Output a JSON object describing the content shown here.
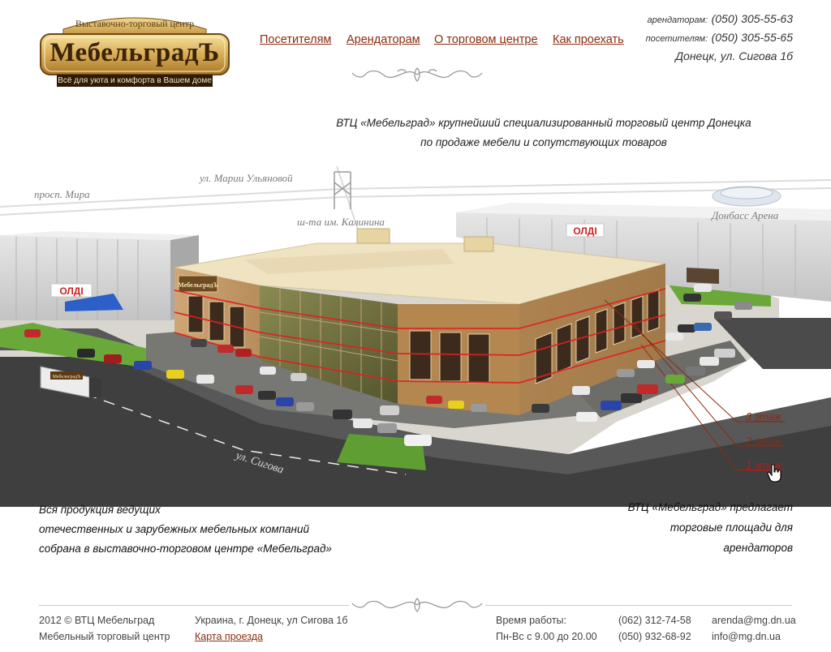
{
  "brand": {
    "subtitle": "Выставочно-торговый центр",
    "name": "МебельградЪ",
    "tagline": "Всё для уюта и комфорта в Вашем доме"
  },
  "nav": [
    {
      "label": "Посетителям"
    },
    {
      "label": "Арендаторам"
    },
    {
      "label": "О торговом центре"
    },
    {
      "label": "Как проехать"
    }
  ],
  "contacts": {
    "tenants_label": "арендаторам:",
    "tenants_phone": "(050) 305-55-63",
    "visitors_label": "посетителям:",
    "visitors_phone": "(050) 305-55-65",
    "address": "Донецк, ул. Сигова 1б"
  },
  "intro": {
    "line1": "ВТЦ «Мебельград» крупнейший специализированный торговый центр Донецка",
    "line2": "по продаже мебели и сопутствующих товаров"
  },
  "map": {
    "streets": {
      "mira": "просп. Мира",
      "ulyanovoy": "ул. Марии Ульяновой",
      "kalinina": "ш-та им. Калинина",
      "donbass_arena": "Донбасс Арена",
      "sigova": "ул. Сигова"
    },
    "store_sign": "ОЛДІ",
    "building_sign": "МебельградЪ",
    "truck_sign": "МебельградЪ",
    "floors": [
      {
        "label": "3 этаж"
      },
      {
        "label": "2 этаж"
      },
      {
        "label": "1 этаж"
      }
    ]
  },
  "info_left": {
    "line1": "Вся продукция ведущих",
    "line2": "отечественных и зарубежных мебельных компаний",
    "line3": "собрана в выставочно-торговом центре «Мебельград»"
  },
  "info_right": {
    "line1": "ВТЦ «Мебельград» предлагает",
    "line2": "торговые площади для",
    "line3": "арендаторов"
  },
  "footer": {
    "copyright": "2012 © ВТЦ Мебельград",
    "company": "Мебельный торговый центр",
    "address": "Украина, г. Донецк, ул Сигова 1б",
    "map_link": "Карта проезда",
    "hours_label": "Время работы:",
    "hours": "Пн-Вс с 9.00 до 20.00",
    "phone1": "(062) 312-74-58",
    "phone2": "(050) 932-68-92",
    "email1": "arenda@mg.dn.ua",
    "email2": "info@mg.dn.ua"
  },
  "colors": {
    "link": "#8b2c0f",
    "building": "#c8a374",
    "roof": "#efe3c2",
    "asphalt": "#4a4a4a",
    "grass": "#6ba83a",
    "floor_highlight": "#e02020"
  }
}
